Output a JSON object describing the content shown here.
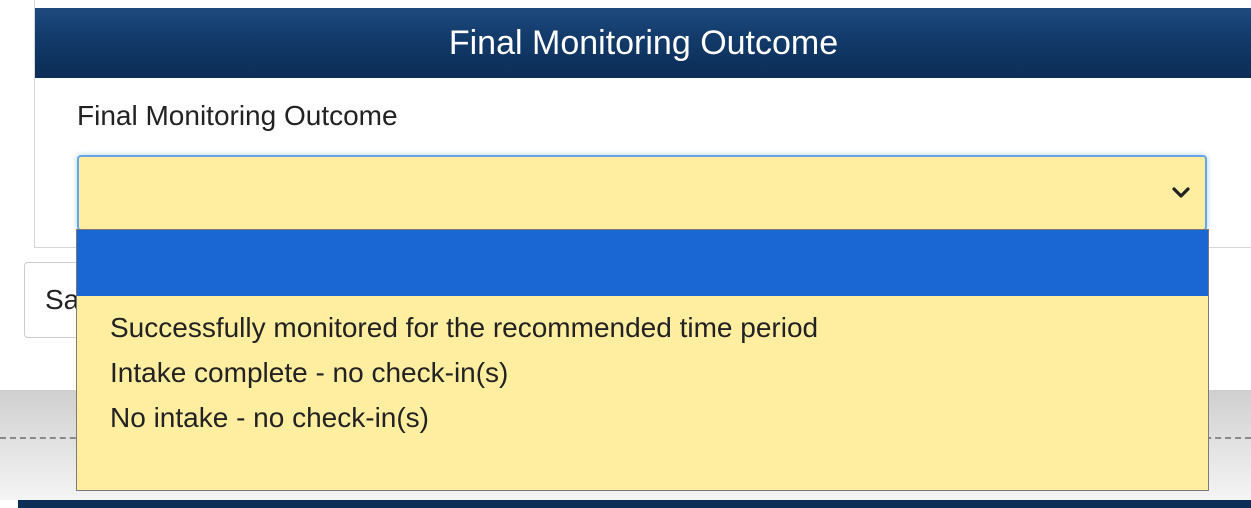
{
  "panel": {
    "header_title": "Final Monitoring Outcome"
  },
  "field": {
    "label": "Final Monitoring Outcome",
    "selected_value": "",
    "icon": "chevron-down-icon"
  },
  "background": {
    "save_button_partial_label": "Sa"
  },
  "dropdown": {
    "options": [
      {
        "label": "",
        "selected": true
      },
      {
        "label": "Successfully monitored for the recommended time period",
        "selected": false
      },
      {
        "label": "Intake complete - no check-in(s)",
        "selected": false
      },
      {
        "label": "No intake - no check-in(s)",
        "selected": false
      }
    ]
  },
  "colors": {
    "header_bg": "#123a69",
    "select_bg": "#ffeda0",
    "selected_option_bg": "#1a66d2",
    "focus_border": "#66a6e8"
  }
}
